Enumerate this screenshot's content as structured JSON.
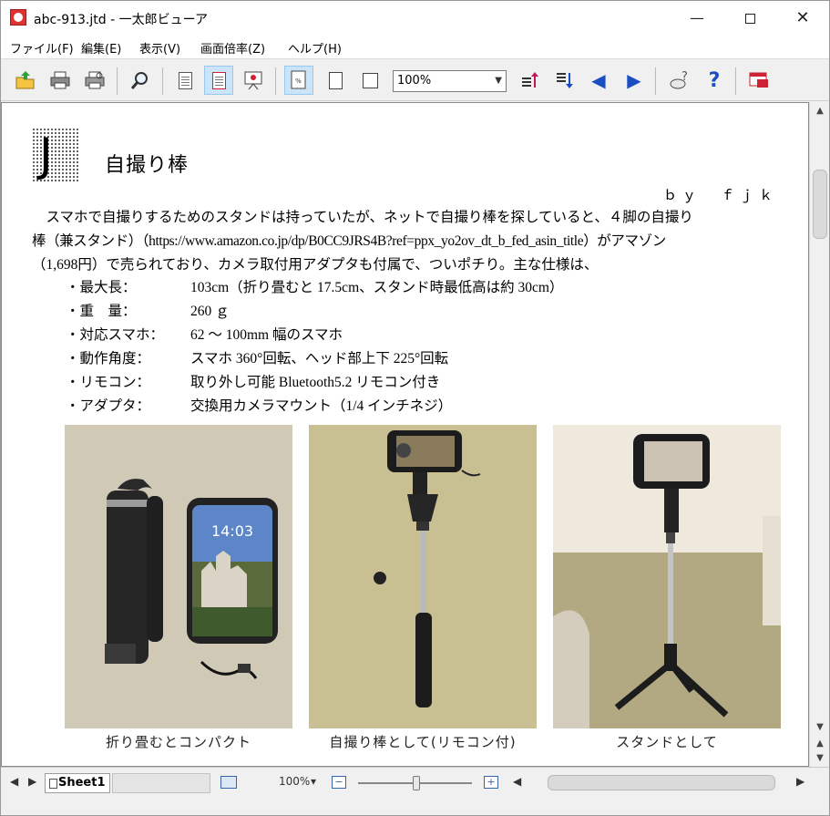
{
  "window": {
    "title": "abc-913.jtd - 一太郎ビューア",
    "min_glyph": "—",
    "close_glyph": "✕"
  },
  "menu": [
    "ファイル(F)",
    "編集(E)",
    "表示(V)",
    "画面倍率(Z)",
    "ヘルプ(H)"
  ],
  "toolbar": {
    "zoom_value": "100%",
    "icons": [
      "open-icon",
      "print-icon",
      "print-preview-icon",
      "find-icon",
      "page-view-icon",
      "layout-view-icon",
      "outline-view-icon",
      "zoom-100-icon",
      "full-page-icon",
      "page-width-icon",
      "prev-heading-icon",
      "next-heading-icon",
      "prev-page-icon",
      "next-page-icon",
      "help-tip-icon",
      "help-icon",
      "ichitaro-icon"
    ]
  },
  "document": {
    "heading_letter": "J",
    "title": "自撮り棒",
    "byline": "ｂｙ　ｆｊｋ",
    "paragraph_lines": [
      "　スマホで自撮りするためのスタンドは持っていたが、ネットで自撮り棒を探していると、４脚の自撮り",
      "棒（兼スタンド）（https://www.amazon.co.jp/dp/B0CC9JRS4B?ref=ppx_yo2ov_dt_b_fed_asin_title）がアマゾン",
      "（1,698円）で売られており、カメラ取付用アダプタも付属で、ついポチり。主な仕様は、"
    ],
    "specs": [
      {
        "label": "・最大長：",
        "value": "103cm（折り畳むと 17.5cm、スタンド時最低高は約 30cm）"
      },
      {
        "label": "・重　量：",
        "value": "260 ｇ"
      },
      {
        "label": "・対応スマホ：",
        "value": "62 〜 100mm 幅のスマホ"
      },
      {
        "label": "・動作角度：",
        "value": "スマホ 360°回転、ヘッド部上下 225°回転"
      },
      {
        "label": "・リモコン：",
        "value": "取り外し可能 Bluetooth5.2 リモコン付き"
      },
      {
        "label": "・アダプタ：",
        "value": "交換用カメラマウント（1/4 インチネジ）"
      }
    ],
    "photos": [
      {
        "caption": "折り畳むとコンパクト",
        "phone_clock": "14:03"
      },
      {
        "caption": "自撮り棒として(リモコン付)"
      },
      {
        "caption": "スタンドとして"
      }
    ]
  },
  "statusbar": {
    "sheet_tab": "Sheet1",
    "zoom": "100%",
    "zoom_arrow": "▾",
    "zoom_minus": "−",
    "zoom_plus": "+"
  }
}
